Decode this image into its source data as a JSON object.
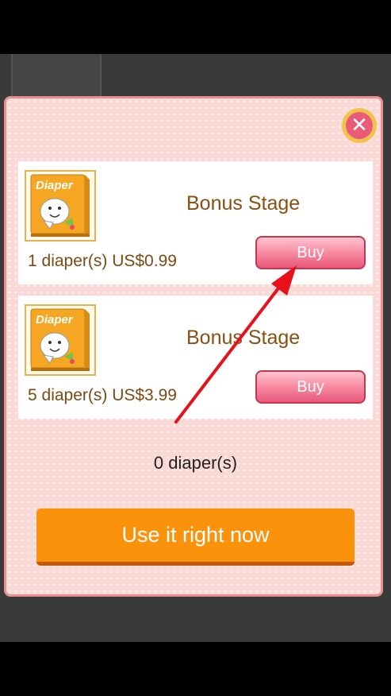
{
  "shop": {
    "items": [
      {
        "title": "Bonus Stage",
        "price_text": "1 diaper(s) US$0.99",
        "buy_label": "Buy",
        "thumb_label": "Diaper",
        "icon": "diaper-pack-icon"
      },
      {
        "title": "Bonus Stage",
        "price_text": "5 diaper(s) US$3.99",
        "buy_label": "Buy",
        "thumb_label": "Diaper",
        "icon": "diaper-pack-icon"
      }
    ],
    "count_text": "0 diaper(s)",
    "use_label": "Use it right now",
    "close_icon": "close-icon"
  },
  "colors": {
    "dialog_bg": "#fbd9d6",
    "buy_button": "#f78aa1",
    "use_button": "#fa930b",
    "title_text": "#8a4f12",
    "annotation_arrow": "#e8101a"
  }
}
